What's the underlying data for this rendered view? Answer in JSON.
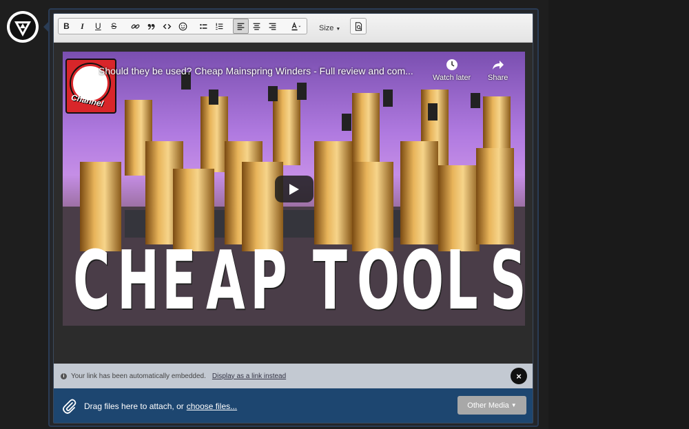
{
  "toolbar": {
    "buttons": [
      {
        "name": "bold-button",
        "label": "B"
      },
      {
        "name": "italic-button",
        "label": "I"
      },
      {
        "name": "underline-button",
        "label": "U"
      },
      {
        "name": "strikethrough-button",
        "label": "S"
      }
    ],
    "size_label": "Size",
    "active_alignment": "left"
  },
  "video": {
    "title": "Should they be used? Cheap Mainspring Winders - Full review and com...",
    "channel_logo_text": "Channel",
    "watch_later_label": "Watch later",
    "share_label": "Share",
    "thumbnail_headline": "CHEAP TOOLS",
    "thumbnail_letters": [
      "C",
      "H",
      "E",
      "A",
      "P",
      " ",
      "T",
      "O",
      "O",
      "L",
      "S"
    ]
  },
  "notice": {
    "message": "Your link has been automatically embedded.",
    "link_label": "Display as a link instead",
    "close_label": "×"
  },
  "attach": {
    "drag_text": "Drag files here to attach, or",
    "choose_label": "choose files...",
    "other_media_label": "Other Media"
  },
  "colors": {
    "attach_bar": "#1d4670",
    "notice_bar": "#c3c9d2",
    "thumbnail_purple": "#b07ae0",
    "page_bg": "#1e1e1e"
  }
}
